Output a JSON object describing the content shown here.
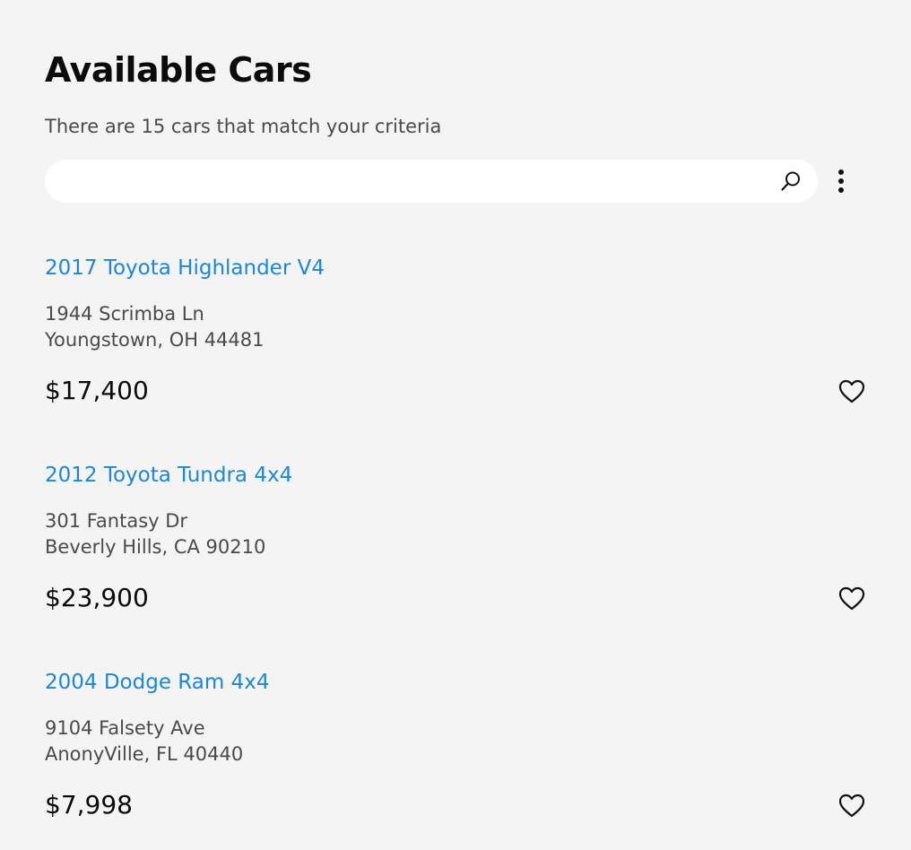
{
  "header": {
    "title": "Available Cars",
    "subtitle": "There are 15 cars that match your criteria"
  },
  "search": {
    "value": "",
    "placeholder": ""
  },
  "icons": {
    "search": "search-icon",
    "more": "more-vertical-icon",
    "favorite": "heart-outline-icon"
  },
  "colors": {
    "background": "#f4f4f4",
    "link": "#1b87d6",
    "text_muted": "#4a4a4a",
    "text_dark": "#0b0b0b"
  },
  "listings": [
    {
      "name": "2017 Toyota Highlander V4",
      "street": "1944 Scrimba Ln",
      "city": "Youngstown, OH 44481",
      "price": "$17,400"
    },
    {
      "name": "2012 Toyota Tundra 4x4",
      "street": "301 Fantasy Dr",
      "city": "Beverly Hills, CA 90210",
      "price": "$23,900"
    },
    {
      "name": "2004 Dodge Ram 4x4",
      "street": "9104 Falsety Ave",
      "city": "AnonyVille, FL 40440",
      "price": "$7,998"
    }
  ]
}
